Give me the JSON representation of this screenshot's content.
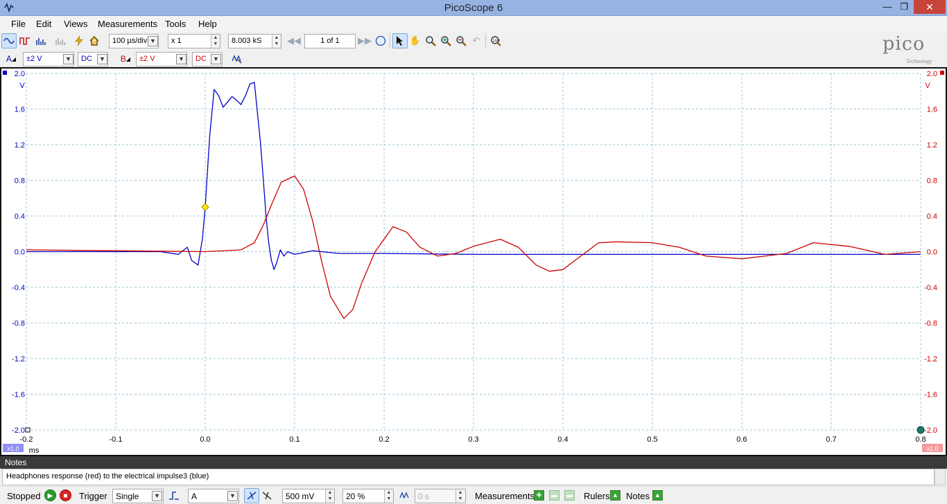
{
  "window": {
    "title": "PicoScope 6"
  },
  "menu": [
    "File",
    "Edit",
    "Views",
    "Measurements",
    "Tools",
    "Help"
  ],
  "toolbar": {
    "timebase": "100 µs/div",
    "zoom": "x 1",
    "samples": "8.003 kS",
    "page": "1 of 1"
  },
  "channels": {
    "a": {
      "label": "A",
      "range": "±2 V",
      "coupling": "DC",
      "color": "#0000c8"
    },
    "b": {
      "label": "B",
      "range": "±2 V",
      "coupling": "DC",
      "color": "#cc0000"
    }
  },
  "logo": {
    "name": "pico",
    "sub": "Technology"
  },
  "chart_data": {
    "type": "line",
    "x_unit": "ms",
    "y_unit": "V",
    "xlim": [
      -0.2,
      0.8
    ],
    "ylim": [
      -2.0,
      2.0
    ],
    "x_ticks": [
      "-0.2",
      "-0.1",
      "0.0",
      "0.1",
      "0.2",
      "0.3",
      "0.4",
      "0.5",
      "0.6",
      "0.7",
      "0.8"
    ],
    "y_ticks_left": [
      "2.0",
      "1.6",
      "1.2",
      "0.8",
      "0.4",
      "0.0",
      "-0.4",
      "-0.8",
      "-1.2",
      "-1.6",
      "-2.0"
    ],
    "y_ticks_right": [
      "2.0",
      "1.6",
      "1.2",
      "0.8",
      "0.4",
      "0.0",
      "-0.4",
      "-0.8",
      "-1.2",
      "-1.6",
      "-2.0"
    ],
    "probe_left": "x1.0",
    "probe_right": "x1.0",
    "grid": true,
    "series": [
      {
        "color": "#0000c8",
        "x": [
          -0.2,
          -0.1,
          -0.05,
          -0.03,
          -0.02,
          -0.015,
          -0.008,
          -0.003,
          0.0,
          0.005,
          0.01,
          0.015,
          0.02,
          0.025,
          0.03,
          0.035,
          0.04,
          0.045,
          0.05,
          0.055,
          0.058,
          0.062,
          0.065,
          0.068,
          0.071,
          0.074,
          0.077,
          0.08,
          0.084,
          0.088,
          0.092,
          0.1,
          0.12,
          0.15,
          0.2,
          0.3,
          0.4,
          0.5,
          0.6,
          0.7,
          0.8
        ],
        "y": [
          0.0,
          0.0,
          0.0,
          -0.03,
          0.05,
          -0.1,
          -0.15,
          0.15,
          0.5,
          1.3,
          1.82,
          1.75,
          1.62,
          1.68,
          1.74,
          1.7,
          1.65,
          1.75,
          1.88,
          1.9,
          1.6,
          1.2,
          0.8,
          0.4,
          0.1,
          -0.1,
          -0.2,
          -0.12,
          0.02,
          -0.05,
          0.0,
          -0.03,
          0.01,
          -0.02,
          -0.02,
          -0.03,
          -0.03,
          -0.03,
          -0.03,
          -0.03,
          -0.03
        ]
      },
      {
        "color": "#cc0000",
        "x": [
          -0.2,
          -0.1,
          0.0,
          0.04,
          0.055,
          0.065,
          0.075,
          0.085,
          0.1,
          0.11,
          0.12,
          0.13,
          0.14,
          0.155,
          0.165,
          0.175,
          0.19,
          0.21,
          0.225,
          0.24,
          0.26,
          0.28,
          0.3,
          0.33,
          0.35,
          0.37,
          0.385,
          0.4,
          0.42,
          0.44,
          0.46,
          0.5,
          0.53,
          0.56,
          0.6,
          0.65,
          0.68,
          0.72,
          0.76,
          0.8
        ],
        "y": [
          0.02,
          0.01,
          0.0,
          0.02,
          0.1,
          0.3,
          0.55,
          0.78,
          0.85,
          0.7,
          0.35,
          -0.1,
          -0.5,
          -0.75,
          -0.65,
          -0.35,
          0.0,
          0.28,
          0.22,
          0.05,
          -0.05,
          -0.02,
          0.06,
          0.14,
          0.05,
          -0.15,
          -0.22,
          -0.2,
          -0.05,
          0.1,
          0.11,
          0.1,
          0.05,
          -0.05,
          -0.08,
          -0.02,
          0.1,
          0.06,
          -0.03,
          0.0
        ]
      }
    ]
  },
  "notes": {
    "title": "Notes",
    "text": "Headphones response (red) to the electrical impulse3 (blue)"
  },
  "status": {
    "state": "Stopped",
    "trigger_label": "Trigger",
    "trigger_mode": "Single",
    "trigger_source": "A",
    "threshold": "500 mV",
    "pretrigger": "20 %",
    "delay": "0 s",
    "measurements": "Measurements",
    "rulers": "Rulers",
    "notes": "Notes"
  }
}
